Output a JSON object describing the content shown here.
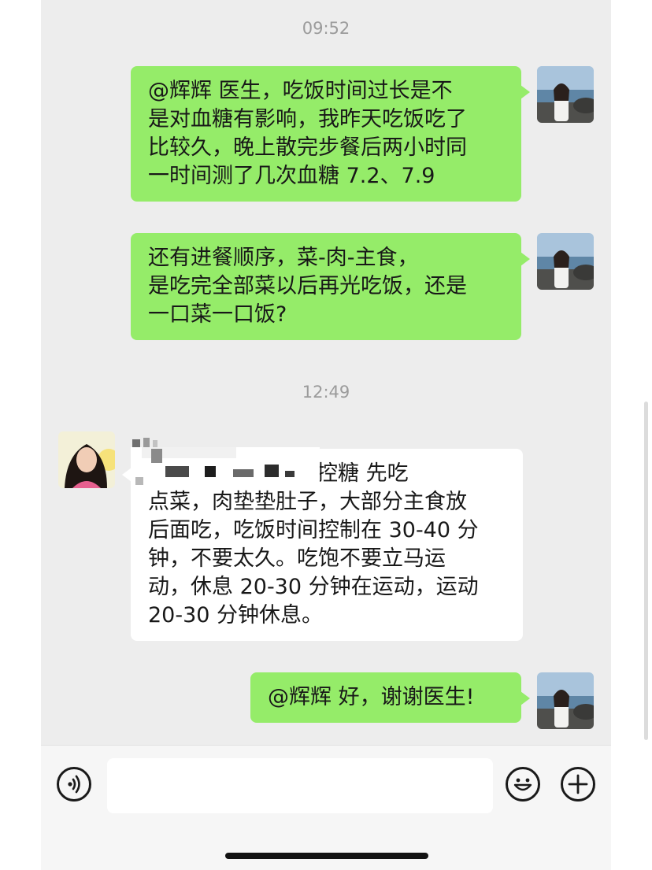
{
  "messages": [
    {
      "type": "time",
      "text": "09:52"
    },
    {
      "type": "outgoing",
      "lines": [
        "@辉辉 医生，吃饭时间过长是不",
        "是对血糖有影响，我昨天吃饭吃了",
        "比较久，晚上散完步餐后两小时同",
        "一时间测了几次血糖 7.2、7.9"
      ]
    },
    {
      "type": "outgoing",
      "lines": [
        "还有进餐顺序，菜-肉-主食，",
        "是吃完全部菜以后再光吃饭，还是",
        "一口菜一口饭?"
      ]
    },
    {
      "type": "time",
      "text": "12:49"
    },
    {
      "type": "incoming",
      "lines": [
        "控糖 先吃",
        "点菜，肉垫垫肚子，大部分主食放",
        "后面吃，吃饭时间控制在 30-40 分",
        "钟，不要太久。吃饱不要立马运",
        "动，休息 20-30 分钟在运动，运动",
        "20-30 分钟休息。"
      ]
    },
    {
      "type": "outgoing",
      "lines": [
        "@辉辉 好，谢谢医生!"
      ]
    }
  ],
  "input_bar": {
    "voice_icon": "voice-icon",
    "emoji_icon": "emoji-icon",
    "plus_icon": "plus-icon",
    "text_value": ""
  },
  "colors": {
    "background": "#ededed",
    "outgoing_bubble": "#95ec69",
    "incoming_bubble": "#ffffff",
    "timestamp": "#9b9b9b"
  }
}
